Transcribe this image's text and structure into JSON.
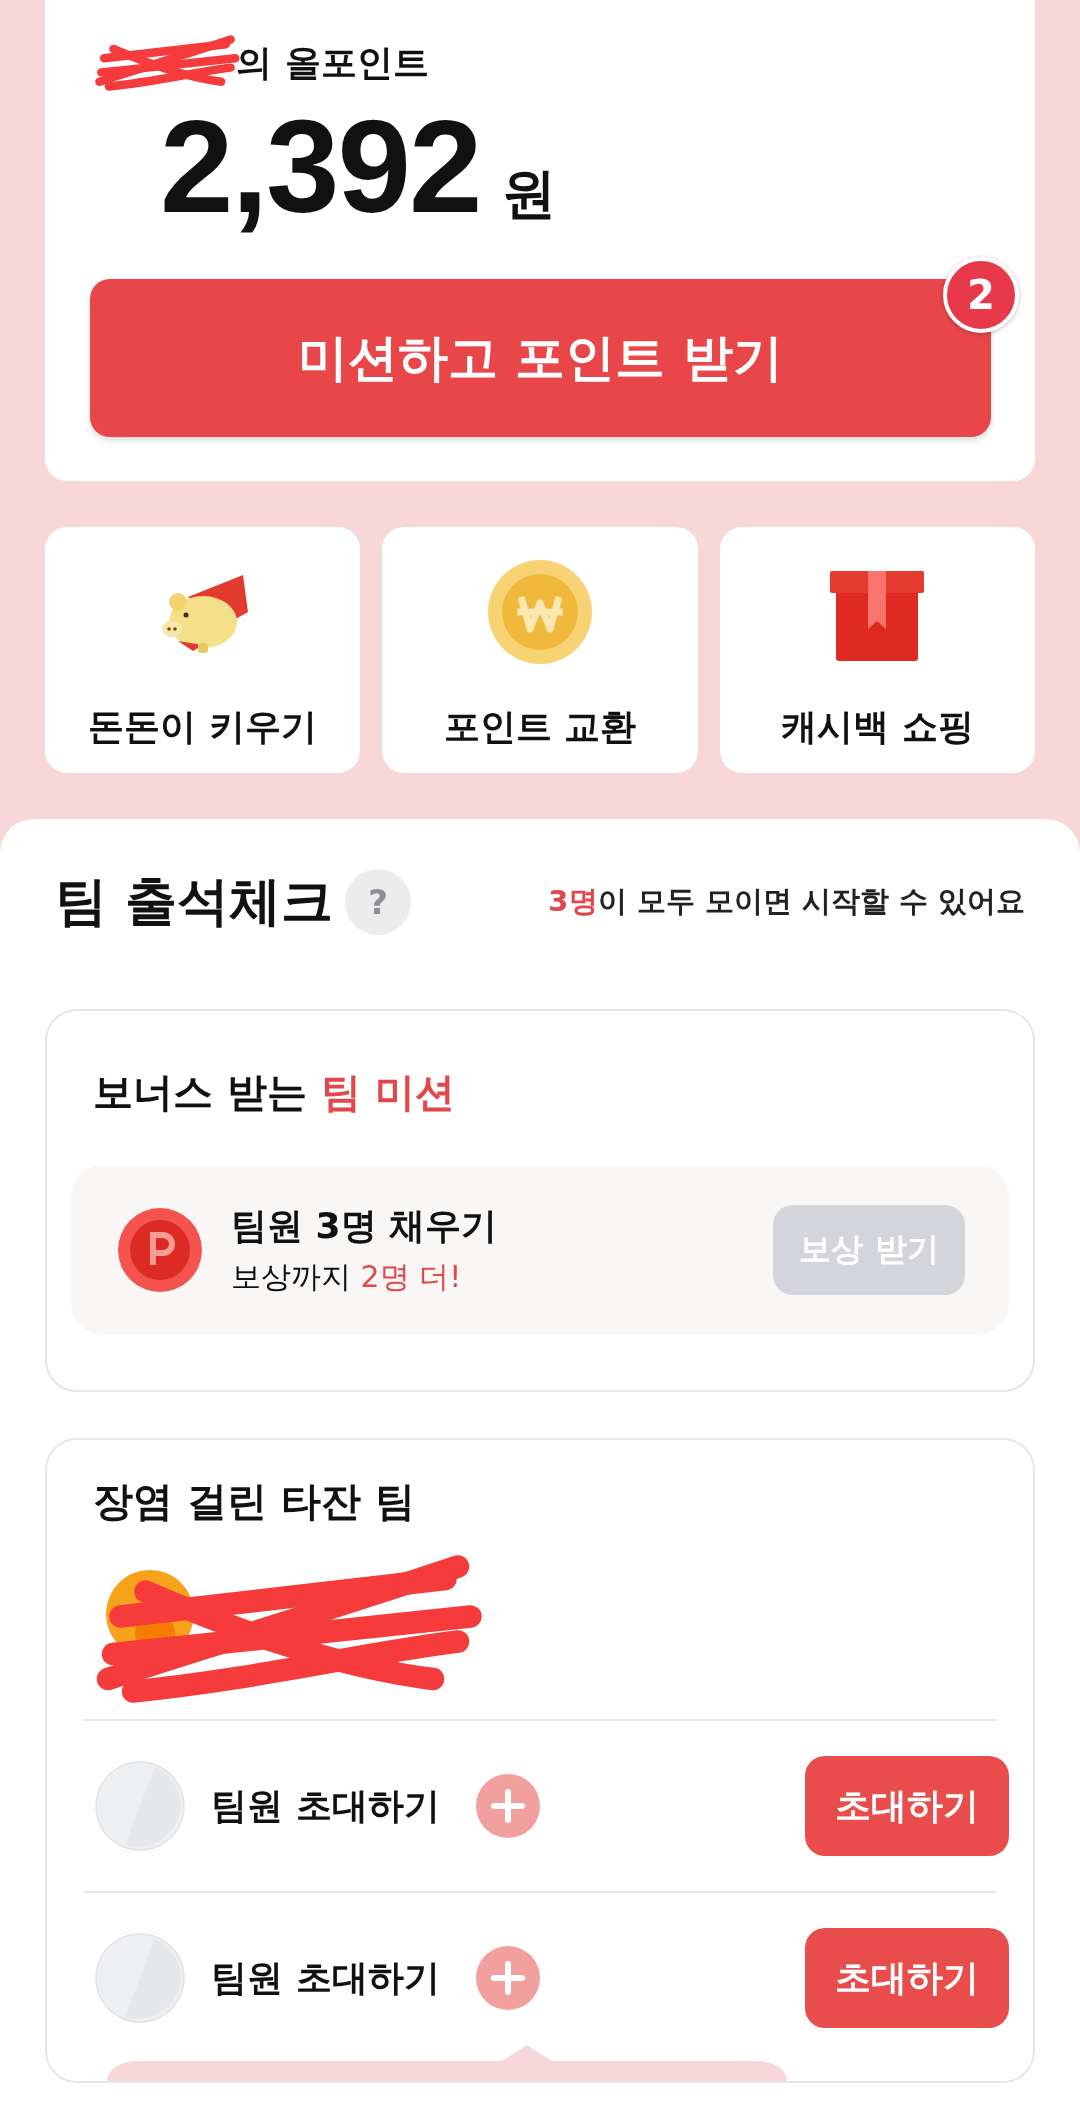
{
  "points_card": {
    "title": "의 올포인트",
    "amount": "2,392",
    "unit": "원",
    "mission_button": "미션하고 포인트 받기",
    "badge": "2"
  },
  "shortcuts": [
    {
      "kind": "piggy",
      "label": "돈돈이 키우기"
    },
    {
      "kind": "coin",
      "label": "포인트 교환"
    },
    {
      "kind": "gift",
      "label": "캐시백 쇼핑"
    }
  ],
  "team": {
    "title": "팀 출석체크",
    "help": "?",
    "notice": "**3명**이 모두 모이면 시작할 수 있어요",
    "bonus": {
      "title": "보너스 받는 **팀 미션**",
      "mission": {
        "title": "팀원 3명 채우기",
        "subtitle": "보상까지 **2명 더!**",
        "button": "보상 받기",
        "disabled": true
      }
    },
    "team_name": "장염 걸린 타잔 팀",
    "members": [
      {
        "kind": "redacted"
      },
      {
        "kind": "invite",
        "label": "팀원 초대하기",
        "button": "초대하기"
      },
      {
        "kind": "invite",
        "label": "팀원 초대하기",
        "button": "초대하기"
      }
    ]
  }
}
